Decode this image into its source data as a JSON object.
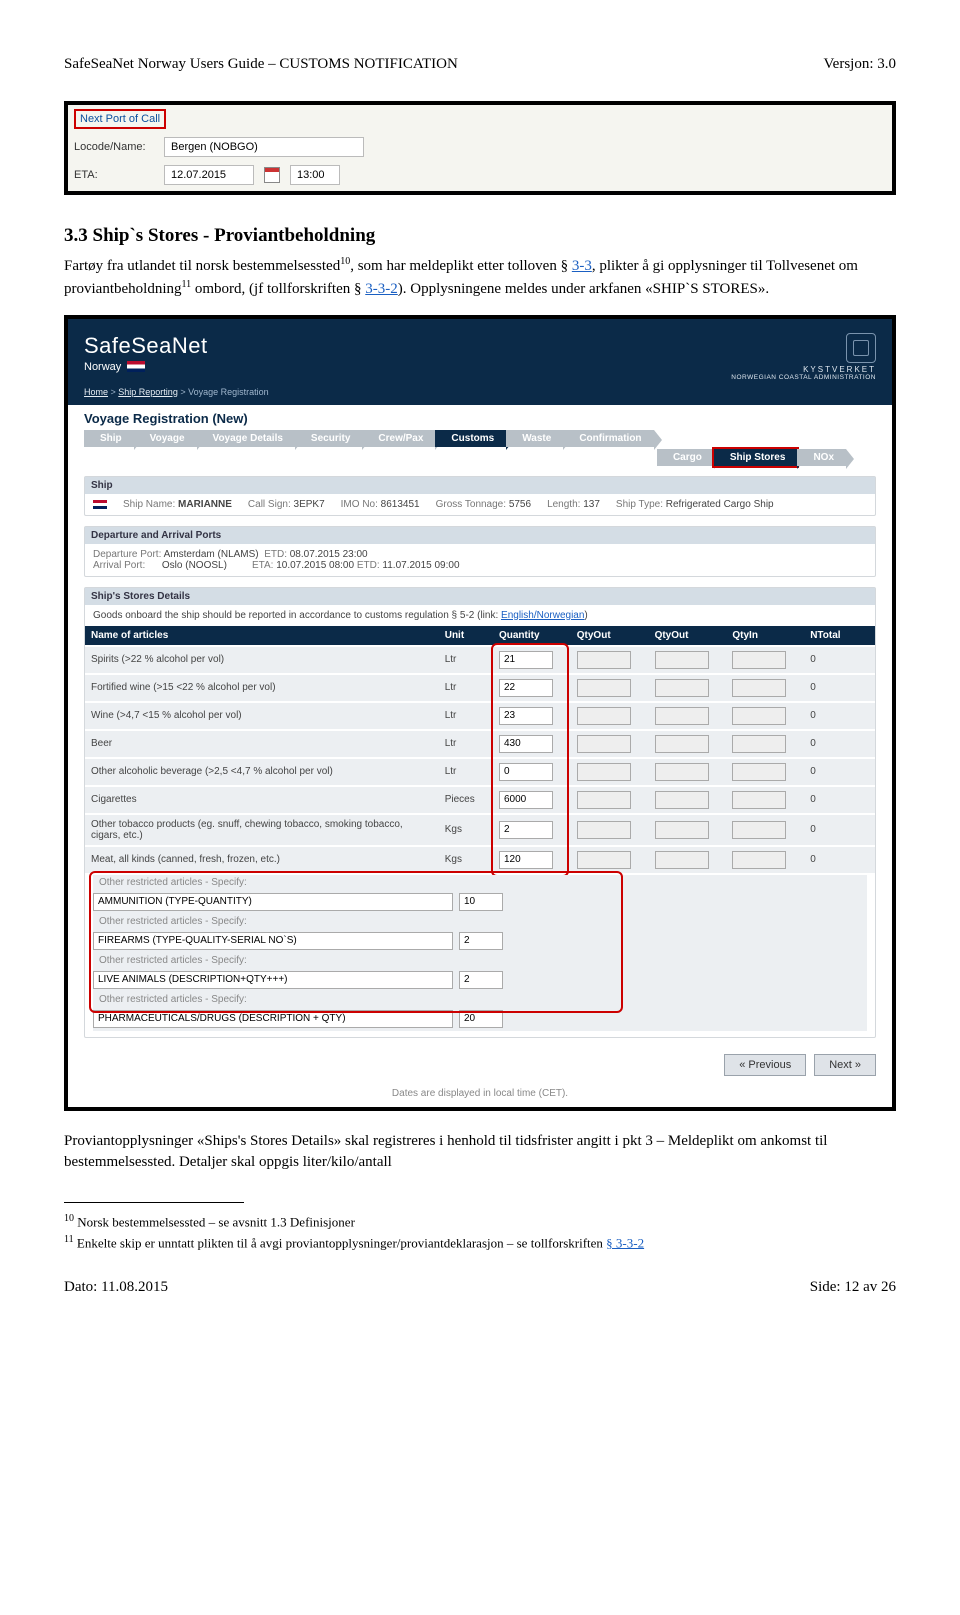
{
  "header": {
    "title": "SafeSeaNet Norway Users Guide – CUSTOMS NOTIFICATION",
    "version": "Versjon: 3.0"
  },
  "fig1": {
    "next_port_label": "Next Port of Call",
    "locode_label": "Locode/Name:",
    "locode_value": "Bergen (NOBGO)",
    "eta_label": "ETA:",
    "eta_date": "12.07.2015",
    "eta_time": "13:00"
  },
  "section": {
    "heading": "3.3 Ship`s Stores - Proviantbeholdning",
    "p1a": "Fartøy fra utlandet til norsk bestemmelsessted",
    "p1b": ", som har meldeplikt etter tolloven § ",
    "p1c": ", plikter å gi opplysninger til Tollvesenet om proviantbeholdning",
    "p1d": " ombord, (jf tollforskriften § ",
    "p1e": "). Opplysningene meldes under arkfanen «SHIP`S STORES».",
    "link33": "3-3",
    "link332": "3-3-2"
  },
  "ssn": {
    "brand": "SafeSeaNet",
    "country": "Norway",
    "kyst1": "KYSTVERKET",
    "kyst2": "NORWEGIAN COASTAL ADMINISTRATION",
    "breadcrumbs": {
      "home": "Home",
      "ship": "Ship Reporting",
      "current": "Voyage Registration"
    },
    "vreg": "Voyage Registration (New)",
    "tabs1": [
      "Ship",
      "Voyage",
      "Voyage Details",
      "Security",
      "Crew/Pax",
      "Customs",
      "Waste",
      "Confirmation"
    ],
    "tabs2": [
      "Cargo",
      "Ship Stores",
      "NOx"
    ],
    "shippanel": {
      "title": "Ship",
      "name_l": "Ship Name:",
      "name_v": "MARIANNE",
      "cs_l": "Call Sign:",
      "cs_v": "3EPK7",
      "imo_l": "IMO No:",
      "imo_v": "8613451",
      "gt_l": "Gross Tonnage:",
      "gt_v": "5756",
      "len_l": "Length:",
      "len_v": "137",
      "type_l": "Ship Type:",
      "type_v": "Refrigerated Cargo Ship"
    },
    "ports": {
      "title": "Departure and Arrival Ports",
      "dep_l": "Departure Port:",
      "dep_v": "Amsterdam (NLAMS)",
      "etd_l": "ETD:",
      "etd_v": "08.07.2015 23:00",
      "arr_l": "Arrival Port:",
      "arr_v": "Oslo (NOOSL)",
      "eta_l": "ETA:",
      "eta_v": "10.07.2015 08:00",
      "etd2_l": "ETD:",
      "etd2_v": "11.07.2015 09:00"
    },
    "stores": {
      "title": "Ship's Stores Details",
      "intro_a": "Goods onboard the ship should be reported in accordance to customs regulation § 5-2 (link: ",
      "intro_link": "English/Norwegian",
      "intro_b": ")",
      "cols": {
        "name": "Name of articles",
        "unit": "Unit",
        "qty": "Quantity",
        "qo1": "QtyOut",
        "qo2": "QtyOut",
        "qi": "QtyIn",
        "nt": "NTotal"
      },
      "rows": [
        {
          "name": "Spirits (>22 % alcohol per vol)",
          "unit": "Ltr",
          "qty": "21",
          "nt": "0"
        },
        {
          "name": "Fortified wine (>15 <22 % alcohol per vol)",
          "unit": "Ltr",
          "qty": "22",
          "nt": "0"
        },
        {
          "name": "Wine (>4,7 <15 % alcohol per vol)",
          "unit": "Ltr",
          "qty": "23",
          "nt": "0"
        },
        {
          "name": "Beer",
          "unit": "Ltr",
          "qty": "430",
          "nt": "0"
        },
        {
          "name": "Other alcoholic beverage (>2,5 <4,7 % alcohol per vol)",
          "unit": "Ltr",
          "qty": "0",
          "nt": "0"
        },
        {
          "name": "Cigarettes",
          "unit": "Pieces",
          "qty": "6000",
          "nt": "0"
        },
        {
          "name": "Other tobacco products (eg. snuff, chewing tobacco, smoking tobacco, cigars, etc.)",
          "unit": "Kgs",
          "qty": "2",
          "nt": "0"
        },
        {
          "name": "Meat, all kinds (canned, fresh, frozen, etc.)",
          "unit": "Kgs",
          "qty": "120",
          "nt": "0"
        }
      ],
      "spec_label": "Other restricted articles - Specify:",
      "specs": [
        {
          "text": "AMMUNITION (TYPE-QUANTITY)",
          "qty": "10"
        },
        {
          "text": "FIREARMS (TYPE-QUALITY-SERIAL NO`S)",
          "qty": "2"
        },
        {
          "text": "LIVE ANIMALS (DESCRIPTION+QTY+++)",
          "qty": "2"
        },
        {
          "text": "PHARMACEUTICALS/DRUGS (DESCRIPTION + QTY)",
          "qty": "20"
        }
      ]
    },
    "prev": "« Previous",
    "next": "Next »",
    "dates_note": "Dates are displayed in local time (CET)."
  },
  "after": {
    "p2": "Proviantopplysninger «Ships's Stores Details» skal registreres i henhold til tidsfrister angitt i pkt 3 – Meldeplikt om ankomst til bestemmelsessted. Detaljer skal oppgis liter/kilo/antall"
  },
  "footnotes": {
    "f10": " Norsk bestemmelsessted – se avsnitt 1.3 Definisjoner",
    "f11a": " Enkelte skip er unntatt plikten til å avgi proviantopplysninger/proviantdeklarasjon – se tollforskriften ",
    "f11link": "§ 3-3-2"
  },
  "footer": {
    "date": "Dato: 11.08.2015",
    "page": "Side: 12 av 26"
  }
}
